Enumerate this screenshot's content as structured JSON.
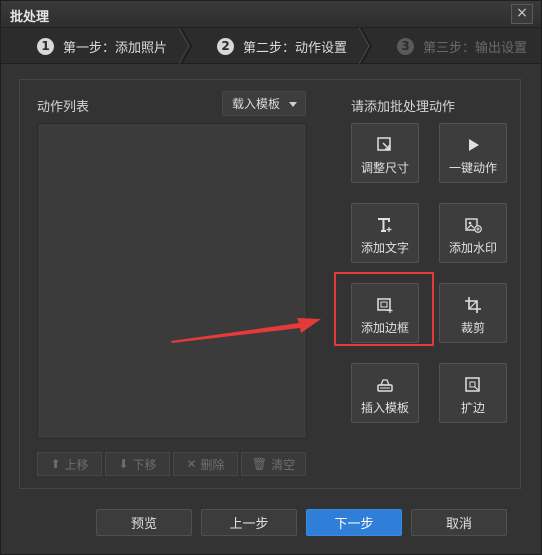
{
  "window": {
    "title": "批处理",
    "close": "×"
  },
  "steps": [
    {
      "num": "1",
      "label": "第一步：添加照片"
    },
    {
      "num": "2",
      "label": "第二步：动作设置"
    },
    {
      "num": "3",
      "label": "第三步：输出设置"
    }
  ],
  "left": {
    "title": "动作列表",
    "template_dropdown": "载入模板",
    "buttons": [
      {
        "icon": "⬆",
        "label": "上移"
      },
      {
        "icon": "⬇",
        "label": "下移"
      },
      {
        "icon": "✕",
        "label": "删除"
      },
      {
        "icon": "🗑",
        "label": "清空"
      }
    ]
  },
  "right": {
    "title": "请添加批处理动作",
    "tiles": [
      {
        "label": "调整尺寸",
        "icon": "resize-icon"
      },
      {
        "label": "一键动作",
        "icon": "play-icon"
      },
      {
        "label": "添加文字",
        "icon": "text-icon"
      },
      {
        "label": "添加水印",
        "icon": "watermark-icon"
      },
      {
        "label": "添加边框",
        "icon": "border-icon"
      },
      {
        "label": "裁剪",
        "icon": "crop-icon"
      },
      {
        "label": "插入模板",
        "icon": "template-icon"
      },
      {
        "label": "扩边",
        "icon": "expand-icon"
      }
    ]
  },
  "footer": {
    "preview": "预览",
    "prev": "上一步",
    "next": "下一步",
    "cancel": "取消"
  },
  "colors": {
    "primary": "#2f7ed8",
    "highlight": "#e53a3a"
  }
}
